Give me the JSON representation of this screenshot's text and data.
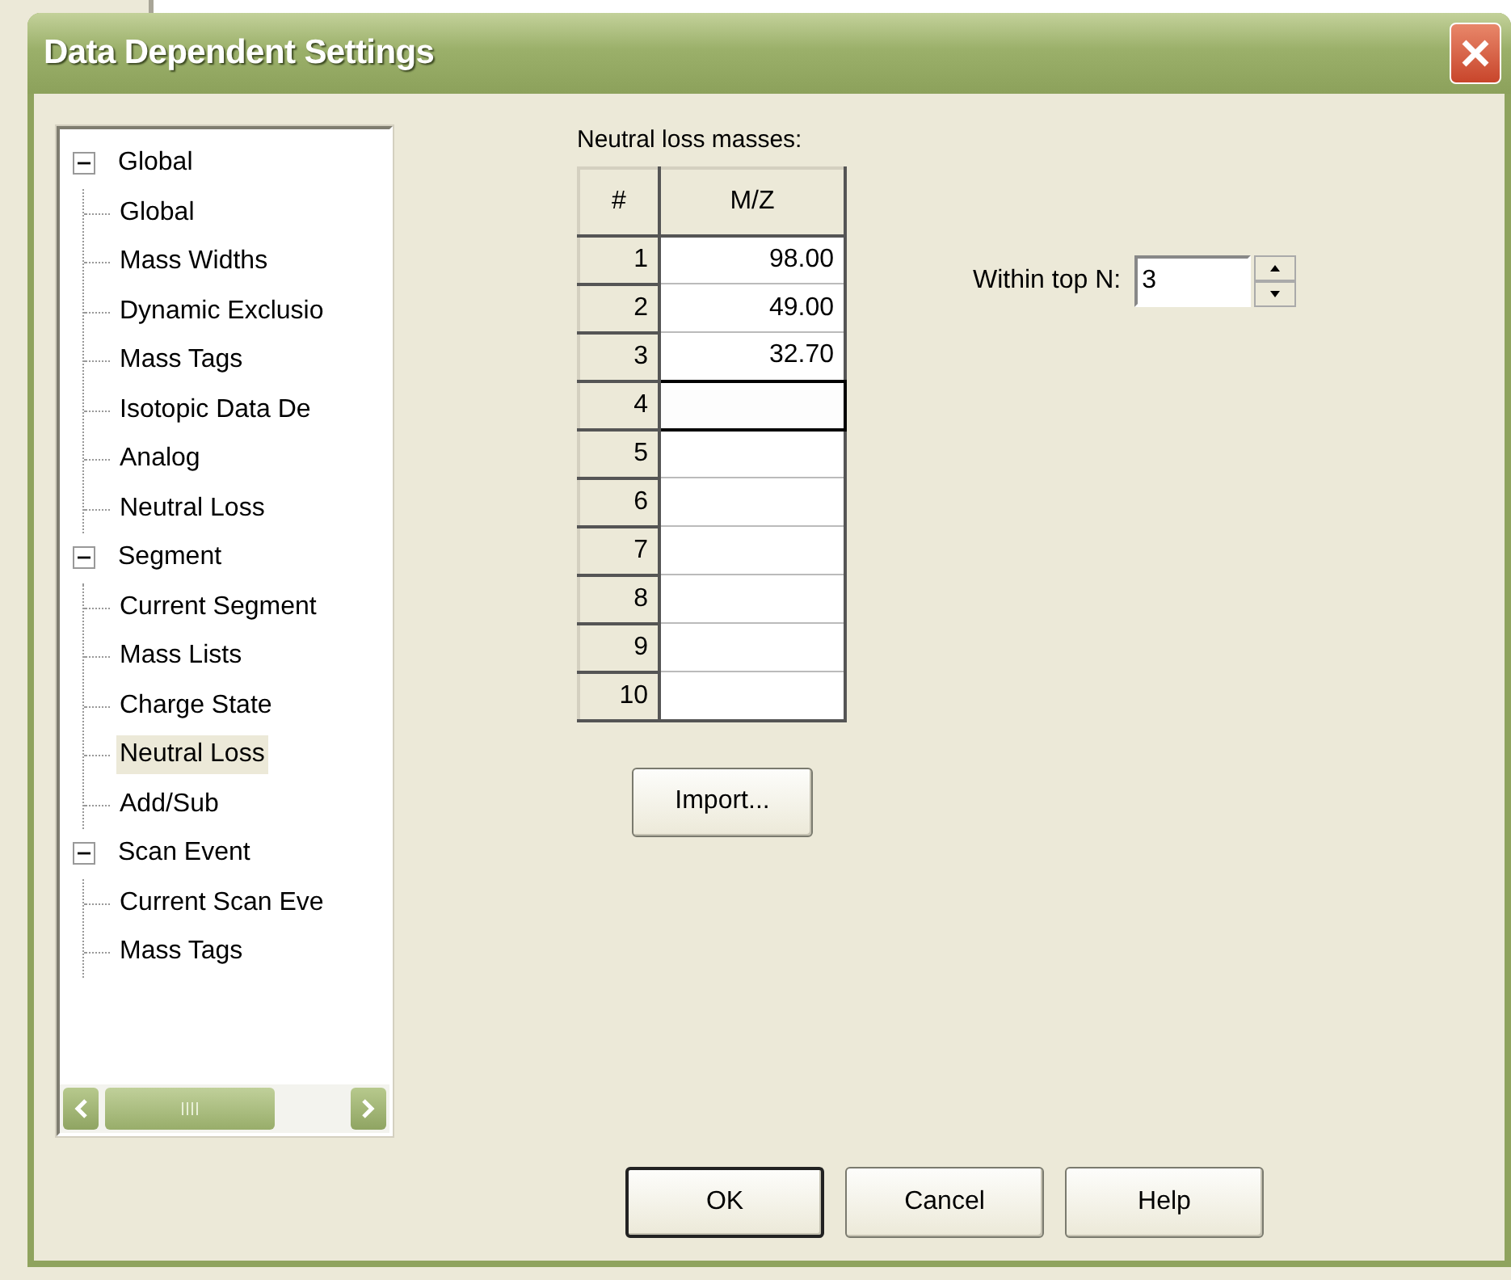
{
  "window": {
    "title": "Data Dependent Settings"
  },
  "tree": [
    {
      "label": "Global",
      "expanded": true,
      "selected": false,
      "children": [
        {
          "label": "Global",
          "selected": false
        },
        {
          "label": "Mass Widths",
          "selected": false
        },
        {
          "label": "Dynamic Exclusio",
          "selected": false
        },
        {
          "label": "Mass Tags",
          "selected": false
        },
        {
          "label": "Isotopic Data De",
          "selected": false
        },
        {
          "label": "Analog",
          "selected": false
        },
        {
          "label": "Neutral Loss",
          "selected": false
        }
      ]
    },
    {
      "label": "Segment",
      "expanded": true,
      "selected": false,
      "children": [
        {
          "label": "Current Segment",
          "selected": false
        },
        {
          "label": "Mass Lists",
          "selected": false
        },
        {
          "label": "Charge State",
          "selected": false
        },
        {
          "label": "Neutral Loss",
          "selected": true
        },
        {
          "label": "Add/Sub",
          "selected": false
        }
      ]
    },
    {
      "label": "Scan Event",
      "expanded": true,
      "selected": false,
      "children": [
        {
          "label": "Current Scan Eve",
          "selected": false
        },
        {
          "label": "Mass Tags",
          "selected": false
        }
      ]
    }
  ],
  "neutral_loss": {
    "label": "Neutral loss masses:",
    "columns": [
      "#",
      "M/Z"
    ],
    "rows": [
      {
        "index": "1",
        "value": "98.00",
        "focused": false
      },
      {
        "index": "2",
        "value": "49.00",
        "focused": false
      },
      {
        "index": "3",
        "value": "32.70",
        "focused": false
      },
      {
        "index": "4",
        "value": "",
        "focused": true
      },
      {
        "index": "5",
        "value": "",
        "focused": false
      },
      {
        "index": "6",
        "value": "",
        "focused": false
      },
      {
        "index": "7",
        "value": "",
        "focused": false
      },
      {
        "index": "8",
        "value": "",
        "focused": false
      },
      {
        "index": "9",
        "value": "",
        "focused": false
      },
      {
        "index": "10",
        "value": "",
        "focused": false
      }
    ]
  },
  "top_n": {
    "label": "Within top N:",
    "value": "3"
  },
  "import_button": "Import...",
  "buttons": [
    {
      "label": "OK",
      "default": true
    },
    {
      "label": "Cancel",
      "default": false
    },
    {
      "label": "Help",
      "default": false
    }
  ]
}
